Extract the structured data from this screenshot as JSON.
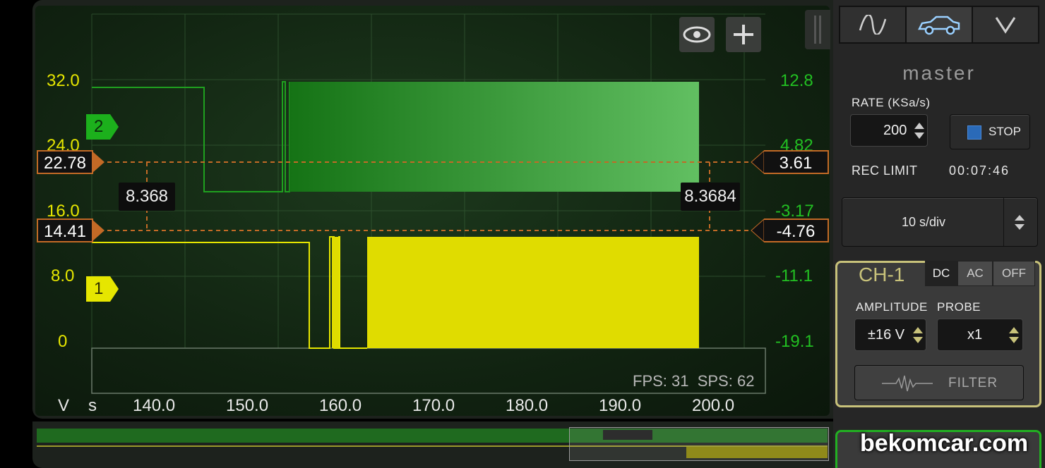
{
  "scope": {
    "y_left_ticks": [
      "32.0",
      "24.0",
      "16.0",
      "8.0",
      "0"
    ],
    "y_right_ticks": [
      "12.8",
      "4.82",
      "-3.17",
      "-11.1",
      "-19.1"
    ],
    "x_ticks": [
      "140.0",
      "150.0",
      "160.0",
      "170.0",
      "180.0",
      "190.0",
      "200.0"
    ],
    "y_unit": "V",
    "x_unit": "s",
    "channel_markers": [
      {
        "label": "2",
        "color": "#1cb01c"
      },
      {
        "label": "1",
        "color": "#e6e600"
      }
    ],
    "cursors": {
      "top_left": "22.78",
      "bottom_left": "14.41",
      "top_right": "3.61",
      "bottom_right": "-4.76",
      "delta_left": "8.368",
      "delta_right": "8.3684"
    },
    "stats": "FPS: 31  SPS: 62",
    "icons": {
      "eye": "eye-icon",
      "add": "plus-icon"
    }
  },
  "panel": {
    "tabs": [
      "sine-wave-icon",
      "car-icon",
      "chevron-down-icon"
    ],
    "mode_title": "master",
    "rate_label": "RATE (KSa/s)",
    "rate_value": "200",
    "stop_label": "STOP",
    "rec_limit_label": "REC LIMIT",
    "rec_limit_value": "00:07:46",
    "timebase": "10 s/div",
    "ch1": {
      "title": "CH-1",
      "coupling": [
        "DC",
        "AC",
        "OFF"
      ],
      "coupling_selected": "DC",
      "amplitude_label": "AMPLITUDE",
      "amplitude_value": "±16 V",
      "probe_label": "PROBE",
      "probe_value": "x1",
      "filter_label": "FILTER"
    }
  },
  "watermark": "bekomcar.com",
  "colors": {
    "ch1": "#e6e600",
    "ch2": "#1fa01f",
    "cursor": "#c36a26",
    "panel_accent": "#c8c27a"
  }
}
